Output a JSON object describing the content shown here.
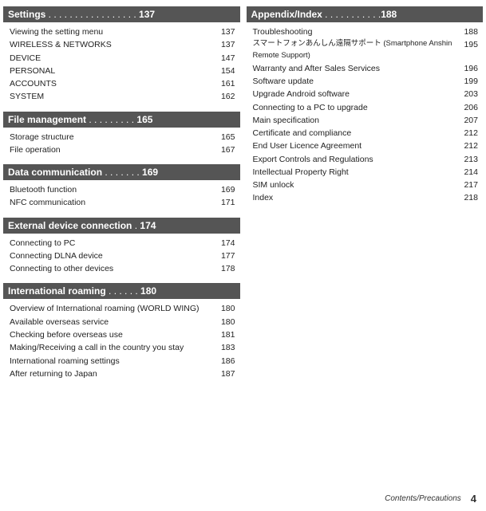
{
  "leftColumn": {
    "sections": [
      {
        "id": "settings",
        "headerLabel": "Settings",
        "headerDots": " . . . . . . . . . . . . . . . . . ",
        "headerPage": "137",
        "entries": [
          {
            "title": "Viewing the setting menu",
            "page": "137"
          },
          {
            "title": "WIRELESS & NETWORKS",
            "page": "137"
          },
          {
            "title": "DEVICE",
            "page": "147"
          },
          {
            "title": "PERSONAL",
            "page": "154"
          },
          {
            "title": "ACCOUNTS",
            "page": "161"
          },
          {
            "title": "SYSTEM",
            "page": "162"
          }
        ]
      },
      {
        "id": "file-management",
        "headerLabel": "File management",
        "headerDots": "  . . . . . . . . . ",
        "headerPage": "165",
        "entries": [
          {
            "title": "Storage structure",
            "page": "165"
          },
          {
            "title": "File operation",
            "page": "167"
          }
        ]
      },
      {
        "id": "data-communication",
        "headerLabel": "Data communication",
        "headerDots": " . . . . . . . ",
        "headerPage": "169",
        "entries": [
          {
            "title": "Bluetooth function",
            "page": "169"
          },
          {
            "title": "NFC communication",
            "page": "171"
          }
        ]
      },
      {
        "id": "external-device",
        "headerLabel": "External device connection",
        "headerDots": " . ",
        "headerPage": "174",
        "entries": [
          {
            "title": "Connecting to PC",
            "page": "174"
          },
          {
            "title": "Connecting DLNA device",
            "page": "177"
          },
          {
            "title": "Connecting to other devices",
            "page": "178"
          }
        ]
      },
      {
        "id": "international-roaming",
        "headerLabel": "International roaming",
        "headerDots": " . . . . . . ",
        "headerPage": "180",
        "entries": [
          {
            "title": "Overview of International roaming (WORLD WING)",
            "page": "180"
          },
          {
            "title": "Available overseas service",
            "page": "180"
          },
          {
            "title": "Checking before overseas use",
            "page": "181"
          },
          {
            "title": "Making/Receiving a call in the country you stay",
            "page": "183"
          },
          {
            "title": "International roaming settings",
            "page": "186"
          },
          {
            "title": "After returning to Japan",
            "page": "187"
          }
        ]
      }
    ]
  },
  "rightColumn": {
    "title": "Appendix/Index",
    "titleDots": " . . . . . . . . . . .",
    "titlePage": "188",
    "entries": [
      {
        "title": "Troubleshooting",
        "page": "188"
      },
      {
        "title": "スマートフォンあんしん遠隔サポート (Smartphone Anshin Remote Support)",
        "page": "195"
      },
      {
        "title": "Warranty and After Sales Services",
        "page": "196"
      },
      {
        "title": "Software update",
        "page": "199"
      },
      {
        "title": "Upgrade Android software",
        "page": "203"
      },
      {
        "title": "Connecting to a PC to upgrade",
        "page": "206"
      },
      {
        "title": "Main specification",
        "page": "207"
      },
      {
        "title": "Certificate and compliance",
        "page": "212"
      },
      {
        "title": "End User Licence Agreement",
        "page": "212"
      },
      {
        "title": "Export Controls and Regulations",
        "page": "213"
      },
      {
        "title": "Intellectual Property Right",
        "page": "214"
      },
      {
        "title": "SIM unlock",
        "page": "217"
      },
      {
        "title": "Index",
        "page": "218"
      }
    ]
  },
  "footer": {
    "label": "Contents/Precautions",
    "pageNumber": "4"
  }
}
